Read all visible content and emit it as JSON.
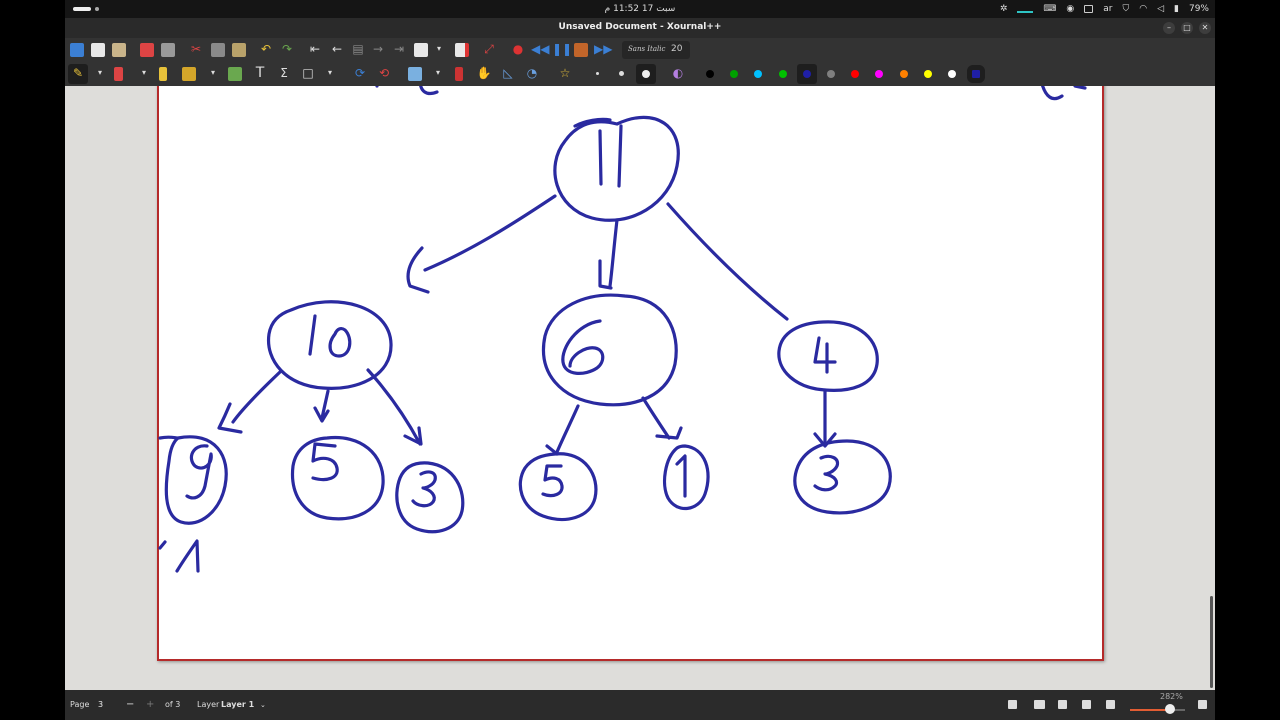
{
  "system_bar": {
    "clock": "سبت 17  11:52 م",
    "lang": "ar",
    "battery": "79%"
  },
  "window": {
    "title": "Unsaved Document - Xournal++",
    "minimize": "–",
    "maximize": "□",
    "close": "✕"
  },
  "toolbar": {
    "font_name": "Sans Italic",
    "font_size": "20",
    "colors": [
      "#000000",
      "#00a000",
      "#00c0ff",
      "#00c000",
      "#1f1fa6",
      "#808080",
      "#ff0000",
      "#ff00ff",
      "#ff8000",
      "#ffff00",
      "#ffffff",
      "#1f1fa6"
    ]
  },
  "document": {
    "tree": {
      "root": "11",
      "level1": [
        "10",
        "6",
        "4"
      ],
      "level2": [
        "9",
        "5",
        "3",
        "5",
        "1",
        "3"
      ],
      "fragments": [
        "-1"
      ]
    },
    "ink_color": "#2a2aa0"
  },
  "statusbar": {
    "page_label": "Page",
    "page_value": "3",
    "page_total": "of 3",
    "layer_label": "Layer",
    "layer_value": "Layer 1",
    "zoom": "282%",
    "zoom_fraction": 0.73
  }
}
